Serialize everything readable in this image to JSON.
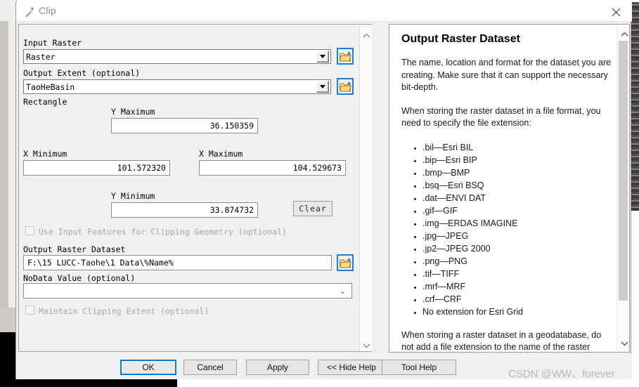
{
  "window": {
    "title": "Clip",
    "icon": "hammer-icon",
    "close_label": "✕"
  },
  "form": {
    "input_raster": {
      "label": "Input Raster",
      "value": "Raster",
      "browse_icon": "open-folder-icon"
    },
    "output_extent": {
      "label": "Output Extent (optional)",
      "value": "TaoHeBasin",
      "browse_icon": "open-folder-icon"
    },
    "rectangle": {
      "label": "Rectangle",
      "y_maximum": {
        "label": "Y Maximum",
        "value": "36.150359"
      },
      "x_minimum": {
        "label": "X Minimum",
        "value": "101.572320"
      },
      "x_maximum": {
        "label": "X Maximum",
        "value": "104.529673"
      },
      "y_minimum": {
        "label": "Y Minimum",
        "value": "33.874732"
      },
      "clear_button": "Clear"
    },
    "use_input_features": {
      "label": "Use Input Features for Clipping Geometry (optional)",
      "checked": false,
      "enabled": false
    },
    "output_raster_dataset": {
      "label": "Output Raster Dataset",
      "value": "F:\\15 LUCC-Taohe\\1 Data\\%Name%",
      "browse_icon": "open-folder-icon"
    },
    "nodata_value": {
      "label": "NoData Value (optional)",
      "value": "",
      "chevron_icon": "chevron-down-icon"
    },
    "maintain_clipping_extent": {
      "label": "Maintain Clipping Extent (optional)",
      "checked": false,
      "enabled": false
    }
  },
  "help": {
    "heading": "Output Raster Dataset",
    "paragraph_1": "The name, location and format for the dataset you are creating. Make sure that it can support the necessary bit-depth.",
    "paragraph_2": "When storing the raster dataset in a file format, you need to specify the file extension:",
    "extensions": [
      ".bil—Esri BIL",
      ".bip—Esri BIP",
      ".bmp—BMP",
      ".bsq—Esri BSQ",
      ".dat—ENVI DAT",
      ".gif—GIF",
      ".img—ERDAS IMAGINE",
      ".jpg—JPEG",
      ".jp2—JPEG 2000",
      ".png—PNG",
      ".tif—TIFF",
      ".mrf—MRF",
      ".crf—CRF",
      "No extension for Esri Grid"
    ],
    "paragraph_3": "When storing a raster dataset in a geodatabase, do not add a file extension to the name of the raster dataset."
  },
  "footer": {
    "ok": "OK",
    "cancel": "Cancel",
    "apply": "Apply",
    "hide_help": "<< Hide Help",
    "tool_help": "Tool Help"
  },
  "watermark": "CSDN @WW、forever",
  "colors": {
    "accent_blue": "#0a7cd4",
    "folder_yellow": "#f5d98a",
    "dialog_bg": "#f0f0f0"
  }
}
